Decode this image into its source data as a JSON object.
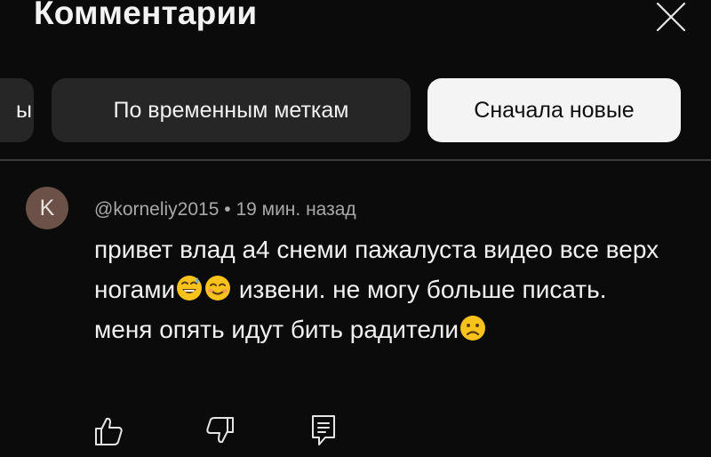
{
  "header": {
    "title": "Комментарии"
  },
  "filters": {
    "partial_label": "ы",
    "timestamps_label": "По временным меткам",
    "newest_label": "Сначала новые",
    "selected": "Сначала новые"
  },
  "comment": {
    "avatar_letter": "K",
    "author": "@korneliy2015",
    "separator": " • ",
    "time": "19 мин. назад",
    "text_1": "привет влад а4 снеми пажалуста видео все верх ногами",
    "text_2": " извени. не могу больше писать. меня опять идут бить радители",
    "emojis": [
      "sweat-smile-emoji",
      "smile-emoji",
      "frown-emoji"
    ]
  },
  "colors": {
    "background": "#0b0b0b",
    "chip": "#262626",
    "chip_selected": "#f4f4f4",
    "avatar": "#6b5148",
    "meta_text": "#a8a8a8"
  },
  "icons": {
    "close": "close-icon",
    "like": "thumbs-up-icon",
    "dislike": "thumbs-down-icon",
    "reply": "reply-icon"
  }
}
